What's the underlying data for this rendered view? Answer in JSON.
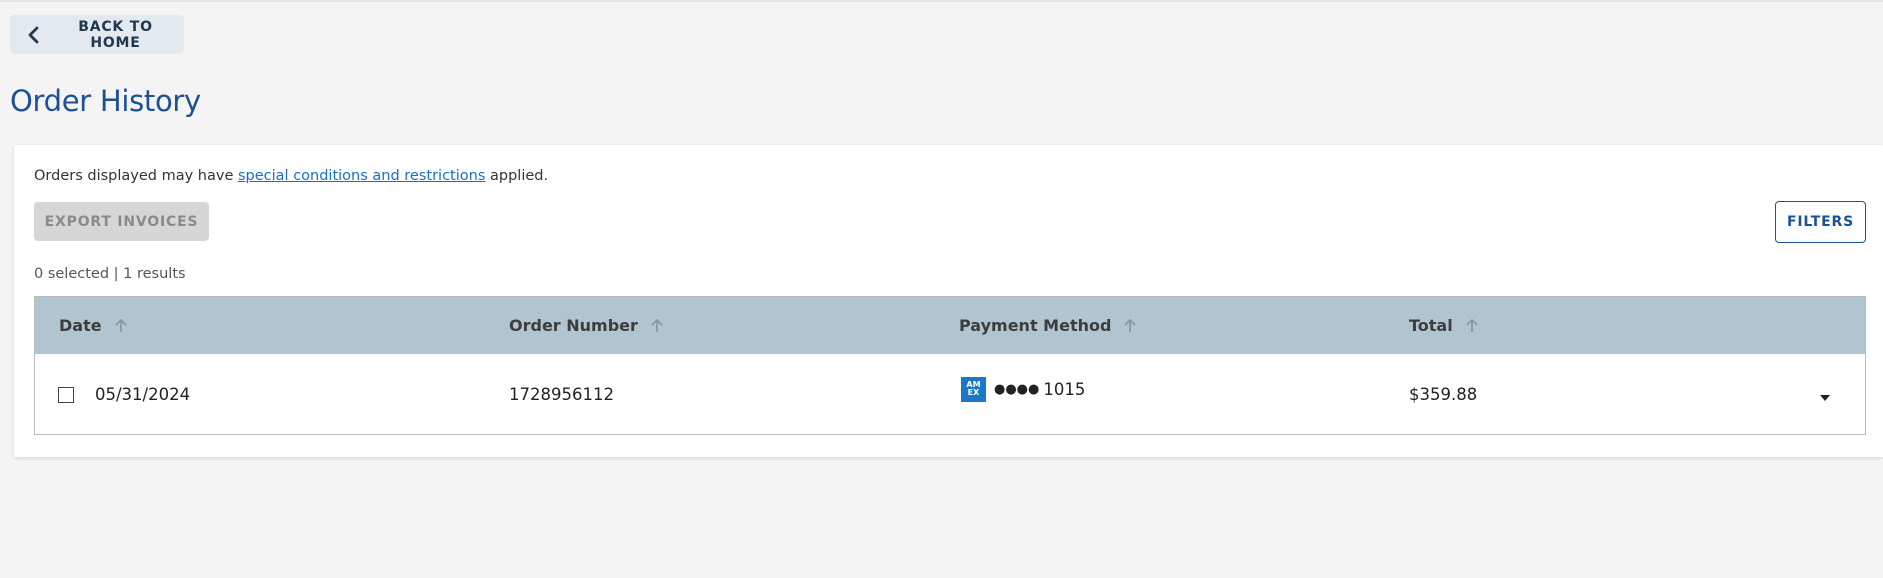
{
  "nav": {
    "back_label": "BACK TO HOME"
  },
  "page": {
    "title": "Order History"
  },
  "notice": {
    "prefix": "Orders displayed may have ",
    "link": "special conditions and restrictions",
    "suffix": " applied."
  },
  "toolbar": {
    "export_label": "EXPORT INVOICES",
    "filters_label": "FILTERS"
  },
  "results": {
    "summary": "0 selected | 1 results"
  },
  "table": {
    "columns": [
      "Date",
      "Order Number",
      "Payment Method",
      "Total"
    ],
    "rows": [
      {
        "date": "05/31/2024",
        "order_number": "1728956112",
        "card_brand": "AM EX",
        "card_mask": "●●●●",
        "card_last4": "1015",
        "total": "$359.88",
        "selected": false
      }
    ]
  },
  "icons": {
    "back": "chevron-left-icon",
    "sort": "arrow-up-icon",
    "expand": "caret-down-icon",
    "card": "amex-card-icon"
  },
  "colors": {
    "page_bg": "#f4f4f4",
    "title": "#1c5196",
    "link": "#1a6fc4",
    "table_header": "#b1c5d1",
    "amex": "#1d77c8"
  }
}
